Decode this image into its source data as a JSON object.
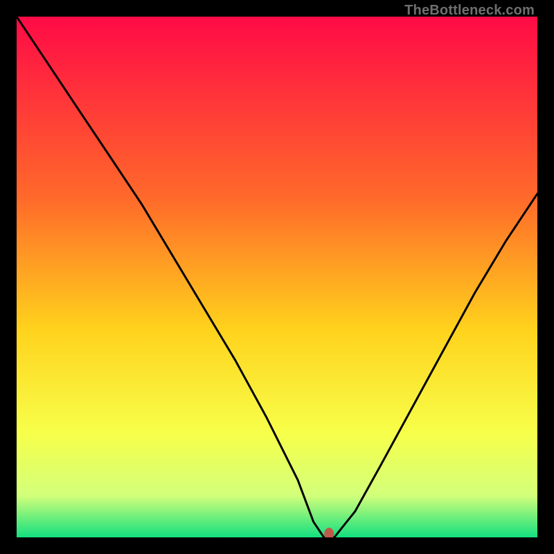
{
  "watermark": "TheBottleneck.com",
  "colors": {
    "gradient_top": "#ff0a46",
    "gradient_mid1": "#ff6a2a",
    "gradient_mid2": "#ffd21c",
    "gradient_mid3": "#f7ff4a",
    "gradient_mid4": "#d2ff7a",
    "gradient_bottom": "#12e07f",
    "curve": "#000000",
    "marker": "#bf5a4a",
    "frame": "#000000"
  },
  "chart_data": {
    "type": "line",
    "title": "",
    "xlabel": "",
    "ylabel": "",
    "xlim": [
      0,
      100
    ],
    "ylim": [
      0,
      100
    ],
    "series": [
      {
        "name": "bottleneck-curve",
        "x": [
          0,
          6,
          12,
          18,
          24,
          30,
          36,
          42,
          48,
          54,
          57,
          59,
          61,
          65,
          70,
          76,
          82,
          88,
          94,
          100
        ],
        "values": [
          100,
          91,
          82,
          73,
          64,
          54,
          44,
          34,
          23,
          11,
          3,
          0,
          0,
          5,
          14,
          25,
          36,
          47,
          57,
          66
        ]
      }
    ],
    "marker": {
      "x": 60,
      "y": 0
    },
    "annotations": []
  }
}
